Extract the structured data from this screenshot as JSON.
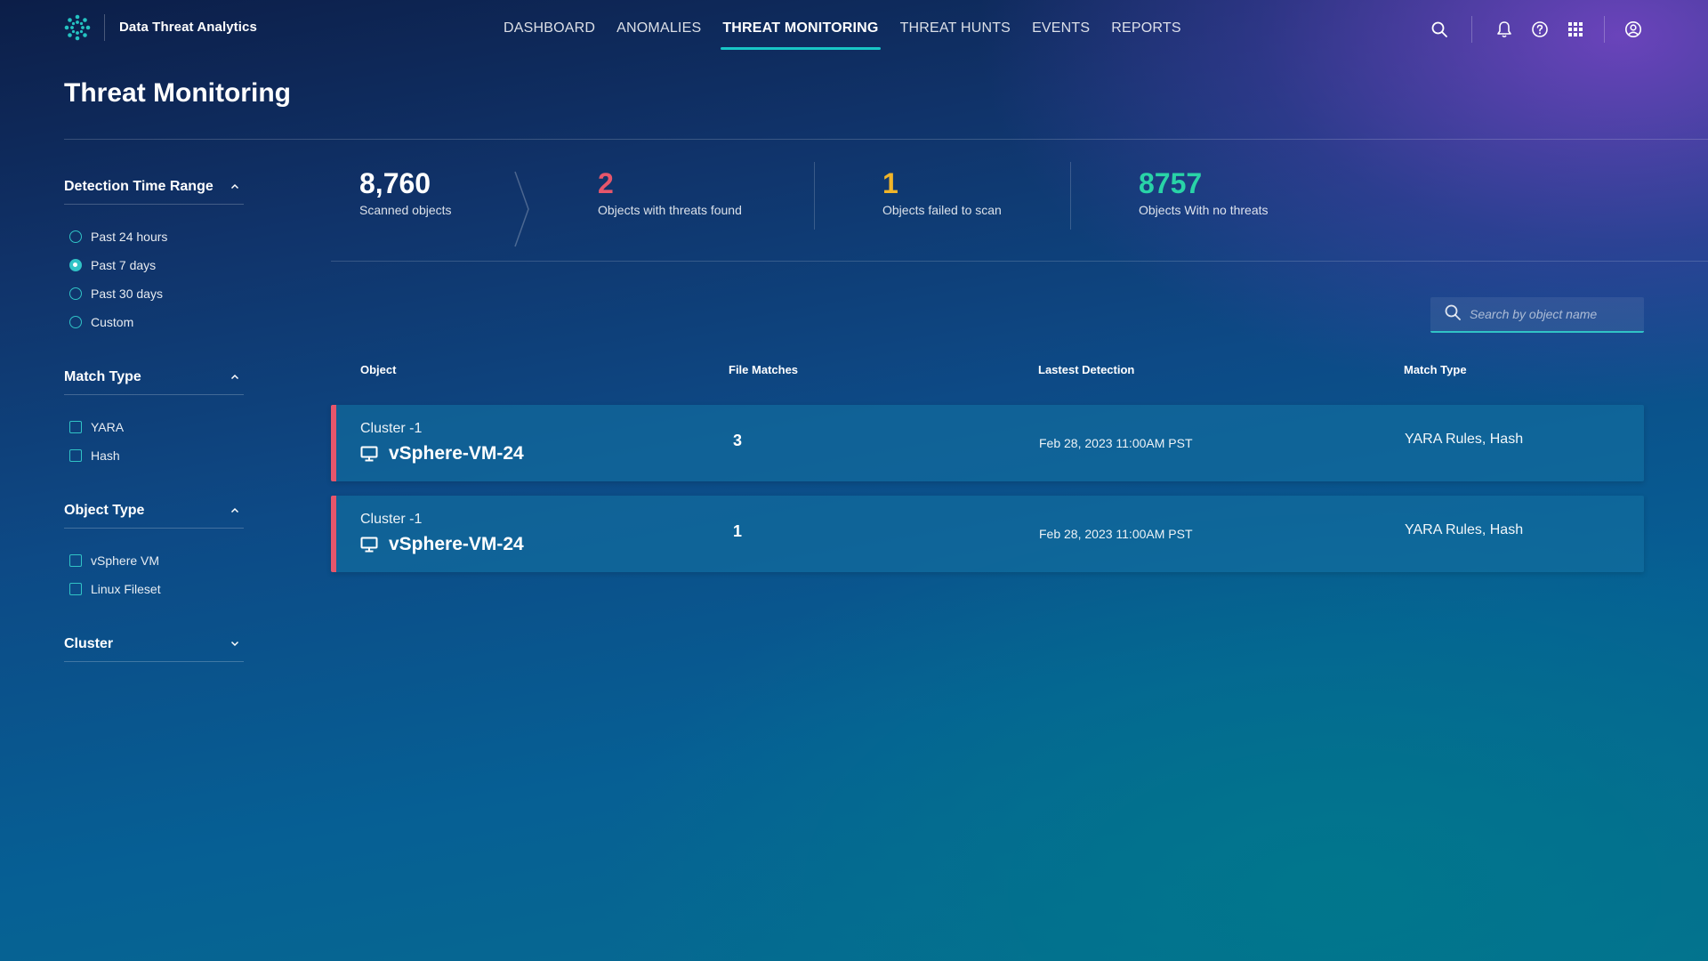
{
  "app": {
    "title": "Data Threat Analytics"
  },
  "nav": {
    "tabs": [
      {
        "label": "DASHBOARD",
        "active": false
      },
      {
        "label": "ANOMALIES",
        "active": false
      },
      {
        "label": "THREAT MONITORING",
        "active": true
      },
      {
        "label": "THREAT HUNTS",
        "active": false
      },
      {
        "label": "EVENTS",
        "active": false
      },
      {
        "label": "REPORTS",
        "active": false
      }
    ],
    "icons": [
      "search-icon",
      "bell-icon",
      "help-icon",
      "apps-grid-icon",
      "account-icon"
    ]
  },
  "page": {
    "title": "Threat Monitoring"
  },
  "filters": {
    "detection_time_range": {
      "title": "Detection Time Range",
      "options": [
        "Past 24 hours",
        "Past 7 days",
        "Past 30 days",
        "Custom"
      ],
      "selected": "Past 7 days"
    },
    "match_type": {
      "title": "Match Type",
      "options": [
        "YARA",
        "Hash"
      ]
    },
    "object_type": {
      "title": "Object Type",
      "options": [
        "vSphere VM",
        "Linux Fileset"
      ]
    },
    "cluster": {
      "title": "Cluster"
    }
  },
  "stats": {
    "scanned": {
      "value": "8,760",
      "label": "Scanned objects"
    },
    "threats": {
      "value": "2",
      "label": "Objects with threats found"
    },
    "failed": {
      "value": "1",
      "label": "Objects failed to scan"
    },
    "no_threats": {
      "value": "8757",
      "label": "Objects With no threats"
    }
  },
  "search": {
    "placeholder": "Search by object name"
  },
  "table": {
    "columns": {
      "object": "Object",
      "file_matches": "File Matches",
      "latest_detection": "Lastest Detection",
      "match_type": "Match Type"
    },
    "rows": [
      {
        "cluster": "Cluster -1",
        "name": "vSphere-VM-24",
        "file_matches": "3",
        "latest_detection": "Feb 28, 2023 11:00AM PST",
        "match_type": "YARA Rules, Hash"
      },
      {
        "cluster": "Cluster -1",
        "name": "vSphere-VM-24",
        "file_matches": "1",
        "latest_detection": "Feb 28, 2023 11:00AM PST",
        "match_type": "YARA Rules, Hash"
      }
    ]
  },
  "colors": {
    "accent": "#18c6c6",
    "threat": "#e6566b",
    "warning": "#f0b429",
    "ok": "#29d3a7"
  }
}
